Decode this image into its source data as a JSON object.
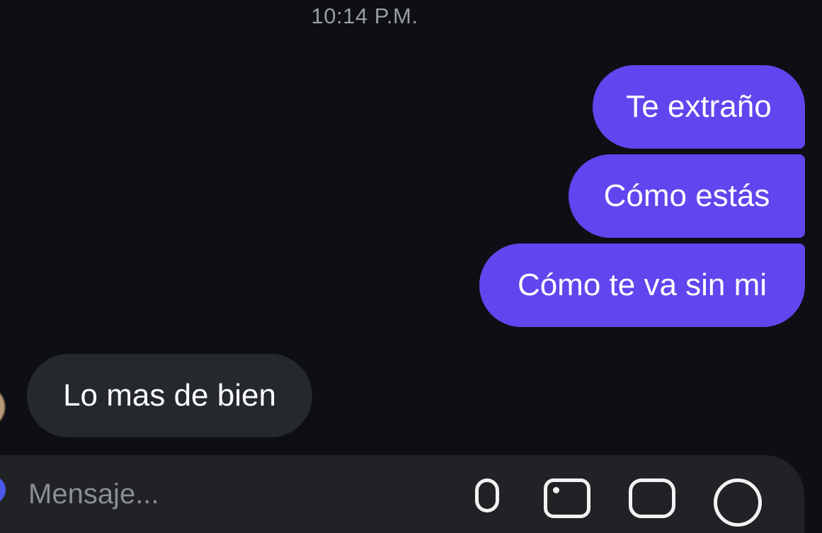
{
  "chat": {
    "timestamp": "10:14 P.M.",
    "messages": [
      {
        "direction": "sent",
        "text": "Te extraño"
      },
      {
        "direction": "sent",
        "text": "Cómo estás"
      },
      {
        "direction": "sent",
        "text": "Cómo te va sin mi"
      },
      {
        "direction": "received",
        "text": "Lo mas de bien"
      }
    ]
  },
  "composer": {
    "placeholder": "Mensaje..."
  },
  "colors": {
    "background": "#0d0f14",
    "sent_bubble": "#6145ee",
    "received_bubble": "#25282d",
    "timestamp_text": "#9a9da4"
  },
  "icons": [
    "microphone-icon",
    "gallery-icon",
    "sticker-icon",
    "plus-icon"
  ]
}
